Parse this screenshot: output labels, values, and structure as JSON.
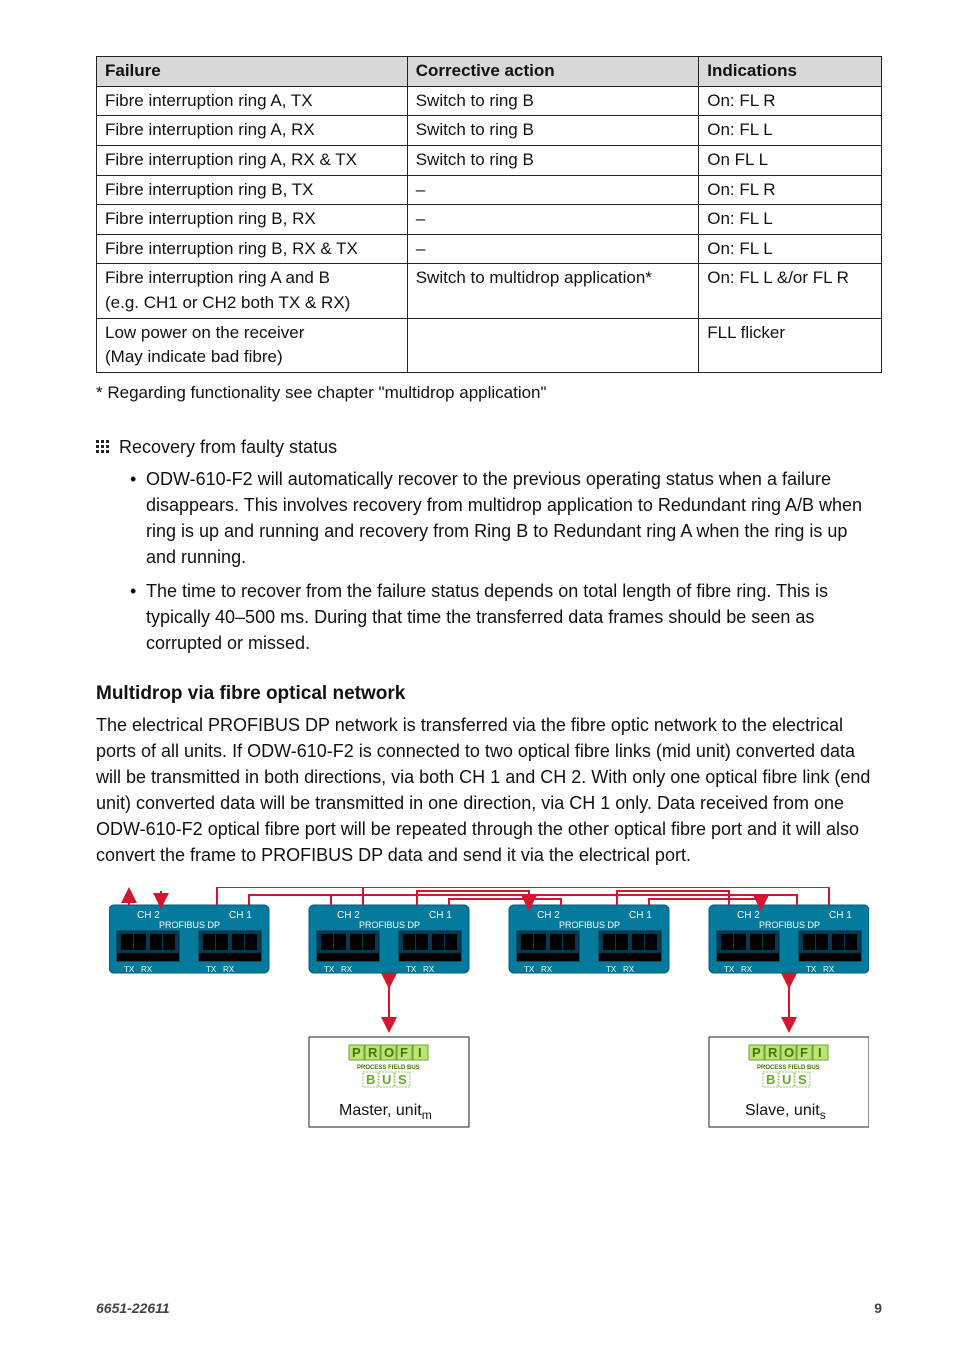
{
  "table": {
    "headers": [
      "Failure",
      "Corrective action",
      "Indications"
    ],
    "rows": [
      {
        "failure": "Fibre interruption ring A, TX",
        "action": "Switch to ring B",
        "ind": "On: FL R"
      },
      {
        "failure": "Fibre interruption ring A, RX",
        "action": "Switch to ring B",
        "ind": "On: FL L"
      },
      {
        "failure": "Fibre interruption ring A, RX & TX",
        "action": "Switch to ring B",
        "ind": "On FL L"
      },
      {
        "failure": "Fibre interruption ring B, TX",
        "action": "–",
        "ind": "On: FL R"
      },
      {
        "failure": "Fibre interruption ring B, RX",
        "action": "–",
        "ind": "On: FL L"
      },
      {
        "failure": "Fibre interruption ring B, RX & TX",
        "action": "–",
        "ind": "On: FL L"
      },
      {
        "failure": "Fibre interruption ring A and B\n(e.g. CH1 or CH2 both TX & RX)",
        "action": "Switch to multidrop application*",
        "ind": "On: FL L &/or FL R"
      },
      {
        "failure": "Low power on the receiver\n(May indicate bad fibre)",
        "action": "",
        "ind": "FLL flicker"
      }
    ]
  },
  "footnote": "* Regarding functionality see chapter \"multidrop application\"",
  "recovery": {
    "title": "Recovery from faulty status",
    "items": [
      "ODW-610-F2 will automatically recover to the previous operating status when a failure disappears. This involves recovery from multidrop application to Redundant ring A/B when ring is up and running and recovery from Ring B to Redundant ring A when the ring is up and running.",
      "The time to recover from the failure status depends on total length of fibre ring. This is typically 40–500 ms. During that time the transferred data frames should be seen as corrupted or missed."
    ]
  },
  "multidrop": {
    "heading": "Multidrop via fibre optical network",
    "body": "The electrical PROFIBUS DP network is transferred via the fibre optic network to the electrical ports of all units. If ODW-610-F2 is connected to two optical fibre links (mid unit) converted data  will be transmitted in both directions, via both CH 1 and CH 2. With only one optical fibre link (end unit) converted data will be transmitted in one direction, via CH 1 only. Data received from one ODW-610-F2 optical fibre port will be repeated through the other optical fibre port and it will also convert the frame to PROFIBUS DP data and send it via the electrical port."
  },
  "diagram": {
    "unit": {
      "ch2": "CH 2",
      "ch1": "CH 1",
      "profibus": "PROFIBUS DP",
      "tx": "TX",
      "rx": "RX"
    },
    "master_box": {
      "brand_line1": "PROFI",
      "brand_line2": "PROCESS FIELD BUS",
      "brand_line3": "BUS",
      "label": "Master, unit",
      "sub": "m"
    },
    "slave_box": {
      "brand_line1": "PROFI",
      "brand_line2": "PROCESS FIELD BUS",
      "brand_line3": "BUS",
      "label": "Slave, unit",
      "sub": "s"
    }
  },
  "footer": {
    "doc": "6651-22611",
    "page": "9"
  }
}
